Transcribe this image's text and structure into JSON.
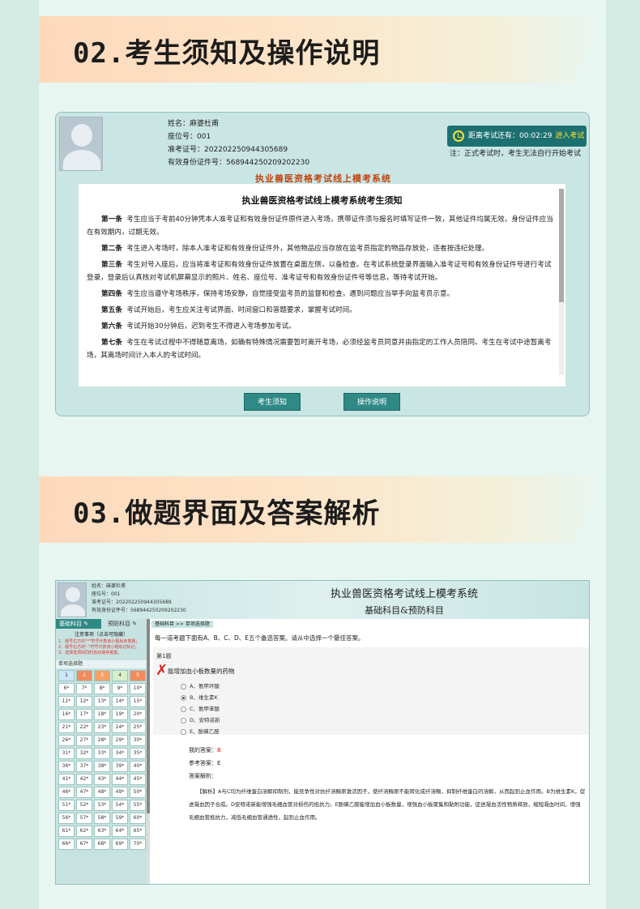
{
  "section1": {
    "title": "02.考生须知及操作说明"
  },
  "section2": {
    "title": "03.做题界面及答案解析"
  },
  "exam_notice": {
    "candidate": {
      "name": "姓名：麻婆杜甫",
      "seat": "座位号：001",
      "ticket": "准考证号：202202250944305689",
      "id": "有效身份证件号：568944250209202230"
    },
    "timer": {
      "label": "距离考试还有：00:02:29",
      "enter": "进入考试"
    },
    "note": "注：正式考试时，考生无法自行开始考试",
    "system_title": "执业兽医资格考试线上模考系统",
    "doc_title": "执业兽医资格考试线上模考系统考生须知",
    "articles": [
      {
        "n": "第一条",
        "t": "考生应当于考前40分钟凭本人准考证和有效身份证件原件进入考场，携带证件须与报名时填写证件一致，其他证件均属无效，身份证件应当在有效期内，过期无效。"
      },
      {
        "n": "第二条",
        "t": "考生进入考场时，除本人准考证和有效身份证件外，其他物品应当存放在监考员指定的物品存放处，违者按违纪处理。"
      },
      {
        "n": "第三条",
        "t": "考生对号入座后，应当将准考证和有效身份证件放置在桌面左侧，以备检查。在考试系统登录界面输入准考证号和有效身份证件号进行考试登录，登录后认真核对考试机屏幕显示的照片、姓名、座位号、准考证号和有效身份证件号等信息，等待考试开始。"
      },
      {
        "n": "第四条",
        "t": "考生应当遵守考场秩序，保持考场安静，自觉接受监考员的监督和检查，遇到问题应当举手向监考员示意。"
      },
      {
        "n": "第五条",
        "t": "考试开始后，考生应关注考试界面、时间窗口和答题要求，掌握考试时间。"
      },
      {
        "n": "第六条",
        "t": "考试开始30分钟后，迟到考生不得进入考场参加考试。"
      },
      {
        "n": "第七条",
        "t": "考生在考试过程中不得随意离场，如确有特殊情况需要暂时离开考场，必须经监考员同意并由指定的工作人员陪同。考生在考试中途暂离考场，其离场时间计入本人的考试时间。"
      }
    ],
    "buttons": {
      "notice": "考生须知",
      "operation": "操作说明"
    }
  },
  "exam_ui": {
    "candidate": {
      "name": "姓名：麻婆杜甫",
      "seat": "座位号：001",
      "ticket": "准考证号：202202250944305689",
      "id": "有效身份证件号：568944250209202230"
    },
    "title": "执业兽医资格考试线上模考系统",
    "subtitle": "基础科目&预防科目",
    "tabs": {
      "basic": "基础科目 ✎",
      "prevent": "预防科目 ✎"
    },
    "notice_title": "注意事项（点击可隐藏）",
    "notices": [
      "1、题号右方的\"*\"符号代表该小题尚未答题；",
      "2、题号右方的\"·\"符号代表该小题有过标记；",
      "3、选择选项的同时自动保存答案。"
    ],
    "qlist_label": "单项选择题",
    "breadcrumb": "基础科目 >> 单项选择题",
    "instruction": "每一道考题下面有A、B、C、D、E五个备选答案。请从中选择一个最佳答案。",
    "question": {
      "number": "第1题",
      "text": "能增加血小板数量的药物",
      "options": [
        "A、氨甲环酸",
        "B、维生素K",
        "C、氨甲苯酸",
        "D、安特诺新",
        "E、酚磺乙胺"
      ],
      "selected": 1
    },
    "my_answer_label": "我的答案：",
    "my_answer": "B",
    "ref_answer": "参考答案：E",
    "analysis_label": "答案解析：",
    "analysis": "【解析】A与C均为纤维蛋白溶解抑制剂，能竞争性对抗纤溶酶原激活因子，使纤溶酶原不能转化成纤溶酶，抑制纤维蛋白的溶解，从而起到止血作用。B为维生素K，促进凝血因子合成。D安特诺新能增强毛细血管对损伤的抵抗力。E酚磺乙胺能增加血小板数量，增强血小板聚集和黏附功能，促进凝血活性物质释放，缩短凝血时间，增强毛细血管抵抗力，减低毛细血管通透性，起到止血作用。",
    "grid": [
      "1",
      "2",
      "3",
      "4",
      "5",
      "6*",
      "7*",
      "8*",
      "9*",
      "10*",
      "11*",
      "12*",
      "13*",
      "14*",
      "15*",
      "16*",
      "17*",
      "18*",
      "19*",
      "20*",
      "21*",
      "22*",
      "23*",
      "24*",
      "25*",
      "26*",
      "27*",
      "28*",
      "29*",
      "30*",
      "31*",
      "32*",
      "33*",
      "34*",
      "35*",
      "36*",
      "37*",
      "38*",
      "39*",
      "40*",
      "41*",
      "42*",
      "43*",
      "44*",
      "45*",
      "46*",
      "47*",
      "48*",
      "49*",
      "50*",
      "51*",
      "52*",
      "53*",
      "54*",
      "55*",
      "56*",
      "57*",
      "58*",
      "59*",
      "60*",
      "61*",
      "62*",
      "63*",
      "64*",
      "65*",
      "66*",
      "67*",
      "68*",
      "69*",
      "70*"
    ]
  }
}
